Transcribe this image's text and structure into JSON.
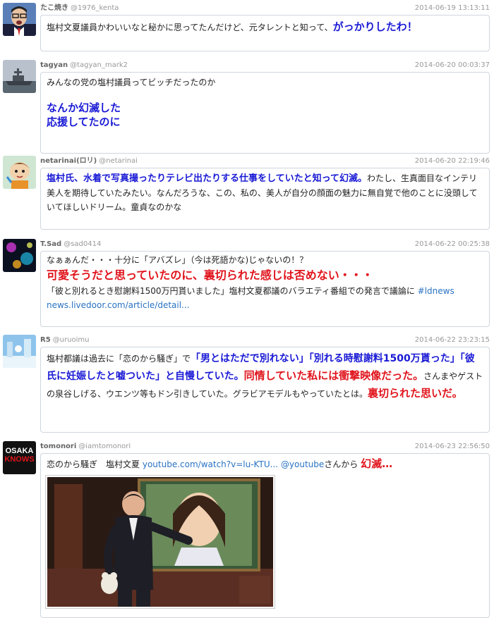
{
  "tweets": [
    {
      "name": "たこ焼き",
      "handle": "@1976_kenta",
      "time": "2014-06-19 13:13:11",
      "avatar": "avatar-man-glasses",
      "text_plain": "塩村文夏議員かわいいなと秘かに思ってたんだけど、元タレントと知って、",
      "text_emph": "がっかりしたわ！"
    },
    {
      "name": "tagyan",
      "handle": "@tagyan_mark2",
      "time": "2014-06-20 00:03:37",
      "avatar": "avatar-ship",
      "line1": "みんなの党の塩村議員ってビッチだったのか",
      "line2": "なんか幻滅した",
      "line3": "応援してたのに"
    },
    {
      "name": "netarinai(ロリ)",
      "handle": "@netarinai",
      "time": "2014-06-20 22:19:46",
      "avatar": "avatar-cartoon-boy",
      "text_emph": "塩村氏、水着で写真撮ったりテレビ出たりする仕事をしていたと知って幻滅。",
      "text_plain": "わたし、生真面目なインテリ美人を期待していたみたい。なんだろうな、この、私の、美人が自分の顔面の魅力に無自覚で他のことに没頭していてほしいドリーム。童貞なのかな"
    },
    {
      "name": "T.Sad",
      "handle": "@sad0414",
      "time": "2014-06-22 00:25:38",
      "avatar": "avatar-night-lights",
      "line1": "なぁぁんだ・・・十分に「アバズレ」（今は死語かな)じゃないの！？",
      "line2": "可愛そうだと思っていたのに、裏切られた感じは否めない・・・",
      "line3": "「彼と別れるとき慰謝料1500万円貰いました」塩村文夏都議のバラエティ番組での発言で議論に",
      "hashtag": "#ldnews",
      "url": "news.livedoor.com/article/detail..."
    },
    {
      "name": "R5",
      "handle": "@uruoimu",
      "time": "2014-06-22 23:23:15",
      "avatar": "avatar-winter-scene",
      "p1": "塩村都議は過去に「恋のから騒ぎ」で",
      "b1": "「男とはただで別れない」「別れる時慰謝料1500万貰った」「彼氏に妊娠したと嘘ついた」と自慢していた。",
      "r1": "同情していた私には衝撃映像だった。",
      "p2": "さんまやゲストの泉谷しげる、ウエンツ等もドン引きしていた。グラビアモデルもやっていたとは。",
      "r2": "裏切られた思いだ。"
    },
    {
      "name": "tomonori",
      "handle": "@iamtomonori",
      "time": "2014-06-23 22:56:50",
      "avatar": "avatar-osaka-knows",
      "avatar_text1": "OSAKA",
      "avatar_text2": "KNOWS",
      "p1": "恋のから騒ぎ　塩村文夏",
      "url": "youtube.com/watch?v=lu-KTU...",
      "mention": "@youtube",
      "p2": "さんから",
      "emph": "幻滅…",
      "image": "tv-show-screenshot"
    }
  ],
  "colors": {
    "blue": "#1a1ad6",
    "red": "#e0141c",
    "link": "#2a73c4",
    "meta": "#999999"
  }
}
